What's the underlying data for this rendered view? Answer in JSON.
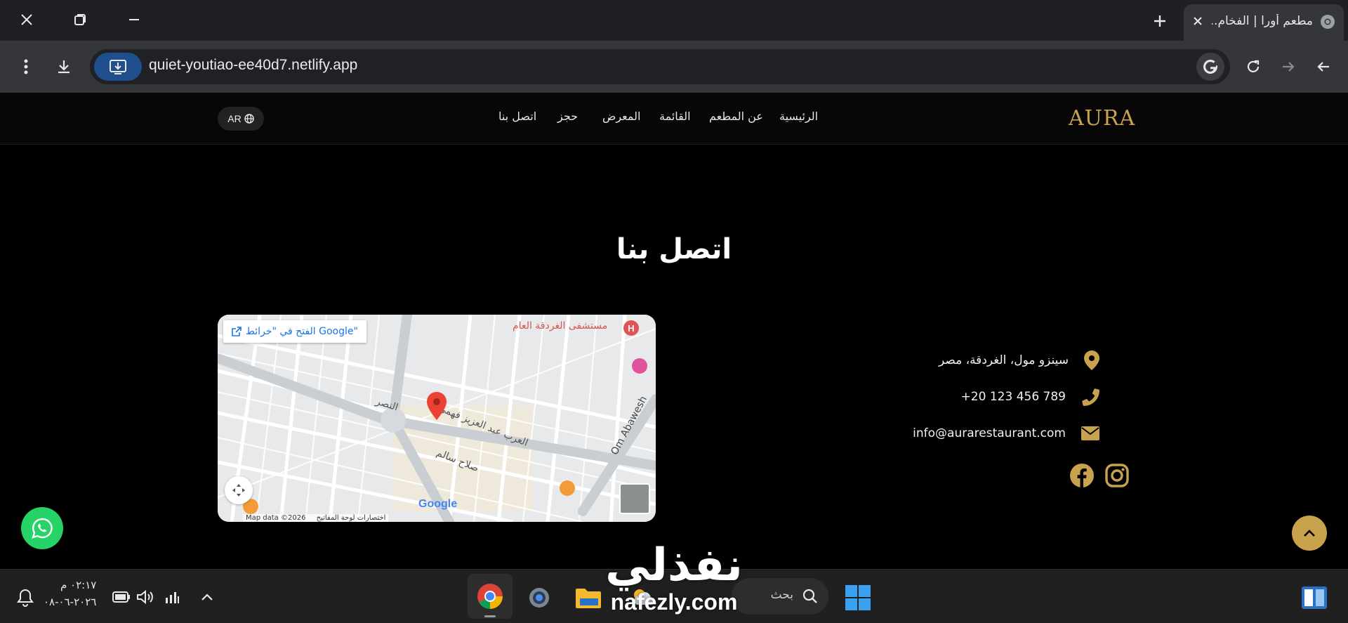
{
  "browser": {
    "tab": {
      "title": "مطعم أورا | الفخام..."
    },
    "url": "quiet-youtiao-ee40d7.netlify.app"
  },
  "site": {
    "logo": "AURA",
    "nav": {
      "home": "الرئيسية",
      "about": "عن المطعم",
      "menu": "القائمة",
      "gallery": "المعرض",
      "booking": "حجز",
      "contact": "اتصل بنا"
    },
    "lang": "AR",
    "section_title": "اتصل بنا",
    "contact": {
      "address": "سينزو مول، الغردقة، مصر",
      "phone": "+20 123 456 789",
      "email": "info@aurarestaurant.com"
    },
    "map": {
      "open_link": "الفتح في \"خرائط Google\"",
      "hospital": "مستشفى الغردقة العام",
      "attribution": "Map data ©2026",
      "shortcuts": "اختصارات لوحة المفاتيح",
      "street1": "العرب عبد العزيز فهمي",
      "street2": "صلاح سالم",
      "street3": "Om Abawesh",
      "street4": "النصر",
      "google": "Google"
    }
  },
  "taskbar": {
    "time": "٠٢:١٧ م",
    "date": "٢٠٢٦-٠٦-٠٨",
    "search": "بحث"
  },
  "watermark": {
    "arabic": "نفذلي",
    "latin": "nafezly.com"
  },
  "colors": {
    "gold": "#c9a24e",
    "whatsapp": "#25d366"
  }
}
